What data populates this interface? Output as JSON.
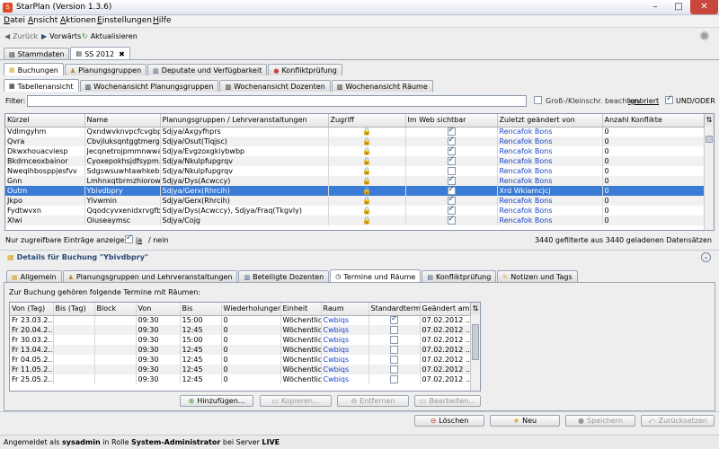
{
  "window": {
    "title": "StarPlan (Version 1.3.6)"
  },
  "menu": [
    {
      "first": "D",
      "rest": "atei"
    },
    {
      "first": "A",
      "rest": "nsicht"
    },
    {
      "first": "A",
      "rest": "ktionen"
    },
    {
      "first": "E",
      "rest": "instellungen"
    },
    {
      "first": "H",
      "rest": "ilfe"
    }
  ],
  "nav": {
    "back": "Zurück",
    "forward": "Vorwärts",
    "refresh": "Aktualisieren"
  },
  "top_tabs": [
    {
      "label": "Stammdaten",
      "active": false,
      "closable": false
    },
    {
      "label": "SS 2012",
      "active": true,
      "closable": true
    }
  ],
  "section_tabs": [
    {
      "label": "Buchungen",
      "active": true,
      "icon": "document-icon"
    },
    {
      "label": "Planungsgruppen",
      "active": false,
      "icon": "group-icon"
    },
    {
      "label": "Deputate und Verfügbarkeit",
      "active": false,
      "icon": "calendar-icon"
    },
    {
      "label": "Konfliktprüfung",
      "active": false,
      "icon": "alert-icon"
    }
  ],
  "view_tabs": [
    {
      "label": "Tabellenansicht",
      "active": true
    },
    {
      "label": "Wochenansicht Planungsgruppen",
      "active": false
    },
    {
      "label": "Wochenansicht Dozenten",
      "active": false
    },
    {
      "label": "Wochenansicht Räume",
      "active": false
    }
  ],
  "filter": {
    "label": "Filter:",
    "value": "",
    "case_label": "Groß-/Kleinschr. beachten/",
    "case_ignore": "ignoriert",
    "case_checked": false,
    "andor_label": "UND/ODER",
    "andor_checked": true
  },
  "main_table": {
    "columns": [
      "Kürzel",
      "Name",
      "Planungsgruppen / Lehrveranstaltungen",
      "Zugriff",
      "Im Web sichtbar",
      "Zuletzt geändert von",
      "Anzahl Konflikte"
    ],
    "rows": [
      {
        "kuerzel": "Vdlmgyhm",
        "name": "Qxndwvknvpcfcvgbpg...",
        "gruppen": "Sdjya/Axgyfhprs",
        "web": true,
        "user": "Rencafok Bons",
        "konflikte": "0"
      },
      {
        "kuerzel": "Qvra",
        "name": "Cbvjluksqntggtmergp...",
        "gruppen": "Sdjya/Osut(Tiqjsc)",
        "web": true,
        "user": "Rencafok Bons",
        "konflikte": "0"
      },
      {
        "kuerzel": "Dkwxhouacviesp",
        "name": "Jecqnetrojpmmnwwat",
        "gruppen": "Sdjya/Evgzoxgkiybwbp",
        "web": true,
        "user": "Rencafok Bons",
        "konflikte": "0"
      },
      {
        "kuerzel": "Bkdrnceoxbainor",
        "name": "Cyoxepokhsjdfsypm...",
        "gruppen": "Sdjya/Nkulpfupgrqv",
        "web": true,
        "user": "Rencafok Bons",
        "konflikte": "0"
      },
      {
        "kuerzel": "Nweqihbosppjesfvv",
        "name": "Sdgswsuwhtawhkebs...",
        "gruppen": "Sdjya/Nkulpfupgrqv",
        "web": false,
        "user": "Rencafok Bons",
        "konflikte": "0"
      },
      {
        "kuerzel": "Gnn",
        "name": "Lmhnxqtbrmzhiorowr",
        "gruppen": "Sdjya/Dys(Acwccy)",
        "web": true,
        "user": "Rencafok Bons",
        "konflikte": "0"
      },
      {
        "kuerzel": "Outm",
        "name": "Ybivdbpry",
        "gruppen": "Sdjya/Gerx(Rhrcih)",
        "web": true,
        "user": "Xrd Wkiamcjcj",
        "konflikte": "0",
        "selected": true
      },
      {
        "kuerzel": "Jkpo",
        "name": "Ylvwmin",
        "gruppen": "Sdjya/Gerx(Rhrcih)",
        "web": true,
        "user": "Rencafok Bons",
        "konflikte": "0"
      },
      {
        "kuerzel": "Fydtwvxn",
        "name": "Qqodcyvxenidxrvgfb...",
        "gruppen": "Sdjya/Dys(Acwccy), Sdjya/Fraq(Tkgvly)",
        "web": true,
        "user": "Rencafok Bons",
        "konflikte": "0"
      },
      {
        "kuerzel": "Xlwi",
        "name": "Oiuseaymsc",
        "gruppen": "Sdjya/Cojg",
        "web": true,
        "user": "Rencafok Bons",
        "konflikte": "0"
      }
    ]
  },
  "only_accessible": {
    "label": "Nur zugreifbare Einträge anzeigen:",
    "checked": true,
    "ja": "ja",
    "nein": "/ nein"
  },
  "record_count": "3440 gefilterte aus 3440 geladenen Datensätzen",
  "details": {
    "title": "Details für Buchung \"Ybivdbpry\""
  },
  "detail_tabs": [
    {
      "label": "Allgemein",
      "active": false
    },
    {
      "label": "Planungsgruppen und Lehrveranstaltungen",
      "active": false
    },
    {
      "label": "Beteiligte Dozenten",
      "active": false
    },
    {
      "label": "Termine und Räume",
      "active": true
    },
    {
      "label": "Konfliktprüfung",
      "active": false
    },
    {
      "label": "Notizen und Tags",
      "active": false
    }
  ],
  "termine": {
    "label": "Zur Buchung gehören folgende Termine mit Räumen:",
    "columns": [
      "Von (Tag)",
      "Bis (Tag)",
      "Block",
      "Von",
      "Bis",
      "Wiederholungen",
      "Einheit",
      "Raum",
      "Standardtermin",
      "Geändert am"
    ],
    "rows": [
      {
        "von_tag": "Fr 23.03.2...",
        "bis_tag": "",
        "block": "",
        "von": "09:30",
        "bis": "15:00",
        "wdh": "0",
        "einheit": "Wöchentlich",
        "raum": "Cwbiqs",
        "std": true,
        "geaendert": "07.02.2012 ..."
      },
      {
        "von_tag": "Fr 20.04.2...",
        "bis_tag": "",
        "block": "",
        "von": "09:30",
        "bis": "12:45",
        "wdh": "0",
        "einheit": "Wöchentlich",
        "raum": "Cwbiqs",
        "std": false,
        "geaendert": "07.02.2012 ..."
      },
      {
        "von_tag": "Fr 30.03.2...",
        "bis_tag": "",
        "block": "",
        "von": "09:30",
        "bis": "15:00",
        "wdh": "0",
        "einheit": "Wöchentlich",
        "raum": "Cwbiqs",
        "std": false,
        "geaendert": "07.02.2012 ..."
      },
      {
        "von_tag": "Fr 13.04.2...",
        "bis_tag": "",
        "block": "",
        "von": "09:30",
        "bis": "12:45",
        "wdh": "0",
        "einheit": "Wöchentlich",
        "raum": "Cwbiqs",
        "std": false,
        "geaendert": "07.02.2012 ..."
      },
      {
        "von_tag": "Fr 04.05.2...",
        "bis_tag": "",
        "block": "",
        "von": "09:30",
        "bis": "12:45",
        "wdh": "0",
        "einheit": "Wöchentlich",
        "raum": "Cwbiqs",
        "std": false,
        "geaendert": "07.02.2012 ..."
      },
      {
        "von_tag": "Fr 11.05.2...",
        "bis_tag": "",
        "block": "",
        "von": "09:30",
        "bis": "12:45",
        "wdh": "0",
        "einheit": "Wöchentlich",
        "raum": "Cwbiqs",
        "std": false,
        "geaendert": "07.02.2012 ..."
      },
      {
        "von_tag": "Fr 25.05.2...",
        "bis_tag": "",
        "block": "",
        "von": "09:30",
        "bis": "12:45",
        "wdh": "0",
        "einheit": "Wöchentlich",
        "raum": "Cwbiqs",
        "std": false,
        "geaendert": "07.02.2012 ..."
      }
    ]
  },
  "detail_buttons": {
    "add": "Hinzufügen...",
    "copy": "Kopieren...",
    "remove": "Entfernen",
    "edit": "Bearbeiten..."
  },
  "bottom_buttons": {
    "delete": "Löschen",
    "new": "Neu",
    "save": "Speichern",
    "reset": "Zurücksetzen"
  },
  "status": {
    "prefix": "Angemeldet als",
    "user": "sysadmin",
    "mid": "in Rolle",
    "role": "System-Administrator",
    "server_prefix": "bei Server",
    "server": "LIVE"
  },
  "colors": {
    "selection": "#3a7bd5",
    "link": "#1c45c8",
    "accent": "#2b4a78",
    "close": "#c9463d"
  }
}
